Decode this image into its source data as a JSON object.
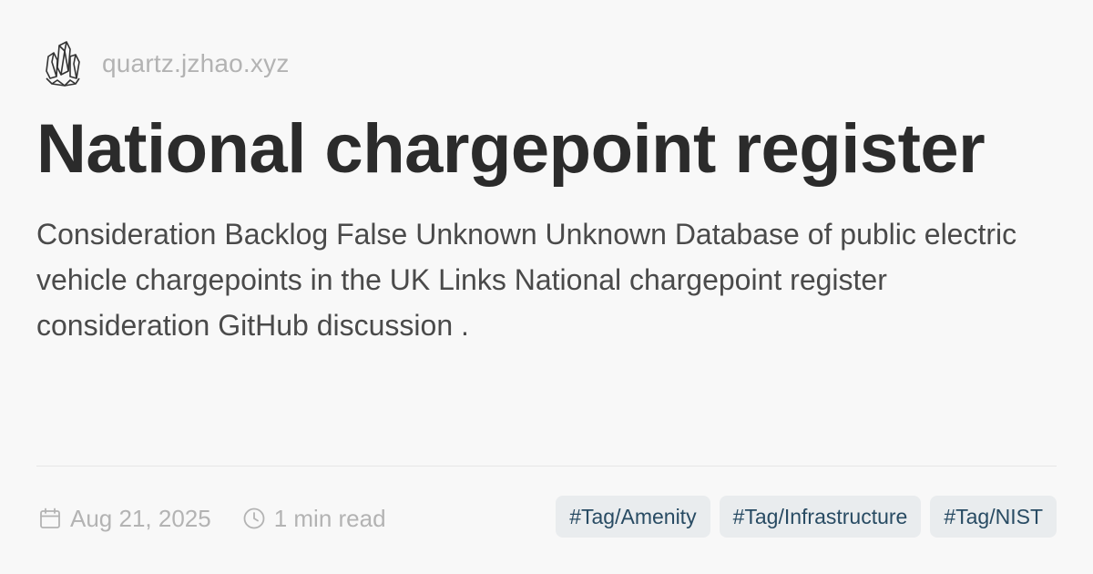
{
  "header": {
    "logo_icon": "crystal-cluster-icon",
    "site_url": "quartz.jzhao.xyz"
  },
  "page": {
    "title": "National chargepoint register",
    "description": "Consideration Backlog False Unknown Unknown Database of public electric vehicle chargepoints in the UK Links National chargepoint register consideration GitHub discussion ."
  },
  "meta": {
    "date_icon": "calendar-icon",
    "date": "Aug 21, 2025",
    "read_icon": "clock-icon",
    "reading_time": "1 min read"
  },
  "tags": [
    "#Tag/Amenity",
    "#Tag/Infrastructure",
    "#Tag/NIST"
  ],
  "colors": {
    "background": "#f8f8f8",
    "title": "#2b2b2b",
    "muted": "#b3b3b3",
    "tag_bg": "#e9ecee",
    "tag_text": "#284b63"
  }
}
